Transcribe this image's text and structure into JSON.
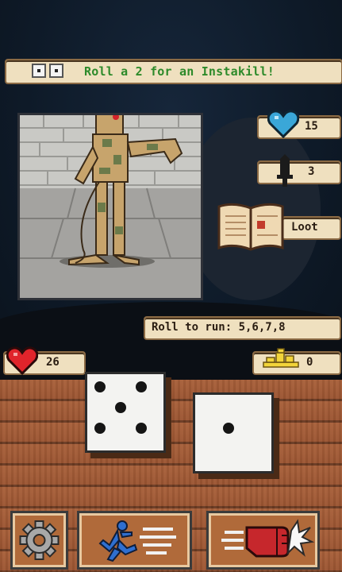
{
  "banner": {
    "text": "Roll a 2 for an Instakill!",
    "dice_faces": [
      1,
      1
    ]
  },
  "monster": {
    "icon": "mummy-icon"
  },
  "stats": {
    "hp": {
      "icon": "blue-heart-icon",
      "value": "15"
    },
    "attack": {
      "icon": "sword-icon",
      "value": "3"
    },
    "loot": {
      "icon": "book-icon",
      "label": "Loot"
    }
  },
  "run": {
    "text": "Roll to run: 5,6,7,8"
  },
  "player": {
    "icon": "red-heart-icon",
    "hp": "26"
  },
  "gold": {
    "icon": "gold-coins-icon",
    "value": "0"
  },
  "dice": [
    {
      "value": 5
    },
    {
      "value": 1
    }
  ],
  "actions": {
    "settings": {
      "icon": "gear-icon"
    },
    "run": {
      "icon": "running-man-icon"
    },
    "attack": {
      "icon": "punch-icon"
    }
  },
  "colors": {
    "banner_text": "#2d8a2a",
    "scroll": "#efe0bf",
    "table": "#a8603a"
  }
}
